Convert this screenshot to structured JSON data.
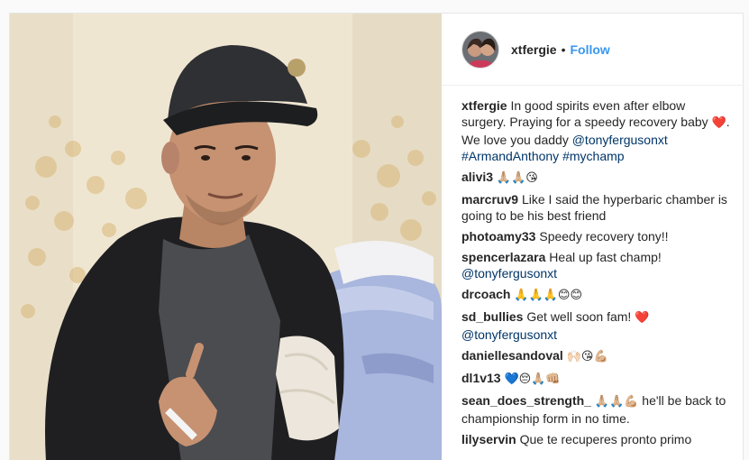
{
  "header": {
    "username": "xtfergie",
    "separator": "•",
    "follow_label": "Follow"
  },
  "caption": {
    "username": "xtfergie",
    "text": "In good spirits even after elbow surgery. Praying for a speedy recovery baby",
    "heart": "❤️",
    "text2": ". We love you daddy",
    "mention": "@tonyfergusonxt",
    "hashtag1": "#ArmandAnthony",
    "hashtag2": "#mychamp"
  },
  "comments": [
    {
      "username": "alivi3",
      "text": "",
      "emoji": "🙏🏼🙏🏼😘"
    },
    {
      "username": "marcruv9",
      "text": "Like I said the hyperbaric chamber is going to be his best friend"
    },
    {
      "username": "photoamy33",
      "text": "Speedy recovery tony!!"
    },
    {
      "username": "spencerlazara",
      "text": "Heal up fast champ!",
      "mention": "@tonyfergusonxt"
    },
    {
      "username": "drcoach",
      "text": "",
      "emoji": "🙏🙏🙏😊😊"
    },
    {
      "username": "sd_bullies",
      "text": "Get well soon fam!",
      "emoji": "❤️",
      "mention": "@tonyfergusonxt"
    },
    {
      "username": "daniellesandoval",
      "text": "",
      "emoji": "🙌🏻😘💪🏼"
    },
    {
      "username": "dl1v13",
      "text": "",
      "emoji": "💙😔🙏🏼👊🏼"
    },
    {
      "username": "sean_does_strength_",
      "emoji": "🙏🏼🙏🏼💪🏼",
      "text": "he'll be back to championship form in no time."
    },
    {
      "username": "lilyservin",
      "text": "Que te recuperes pronto primo"
    }
  ],
  "colors": {
    "link": "#003569",
    "follow": "#3897f0",
    "heart": "#e0245e"
  }
}
